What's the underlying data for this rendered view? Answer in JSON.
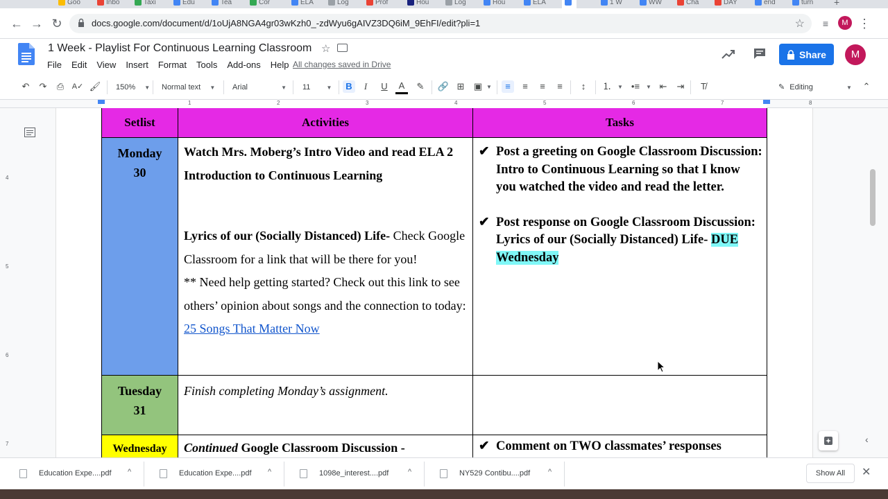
{
  "browser": {
    "tabs": [
      {
        "label": "Goo",
        "color": "#fbbc04"
      },
      {
        "label": "Inbo",
        "color": "#ea4335"
      },
      {
        "label": "Taxi",
        "color": "#34a853"
      },
      {
        "label": "Edu",
        "color": "#4285f4"
      },
      {
        "label": "Tea",
        "color": "#4285f4"
      },
      {
        "label": "Cor",
        "color": "#34a853"
      },
      {
        "label": "ELA",
        "color": "#4285f4"
      },
      {
        "label": "Log",
        "color": "#9aa0a6"
      },
      {
        "label": "Prof",
        "color": "#ea4335"
      },
      {
        "label": "Hou",
        "color": "#1a237e"
      },
      {
        "label": "Log",
        "color": "#9aa0a6"
      },
      {
        "label": "Hou",
        "color": "#4285f4"
      },
      {
        "label": "ELA",
        "color": "#4285f4"
      },
      {
        "label": "",
        "color": "#4285f4"
      },
      {
        "label": "1 W",
        "color": "#4285f4"
      },
      {
        "label": "WW",
        "color": "#4285f4"
      },
      {
        "label": "Cha",
        "color": "#ea4335"
      },
      {
        "label": "DAY",
        "color": "#ea4335"
      },
      {
        "label": "end",
        "color": "#4285f4"
      },
      {
        "label": "turn",
        "color": "#4285f4"
      }
    ],
    "url": "docs.google.com/document/d/1oUjA8NGA4gr03wKzh0_-zdWyu6gAIVZ3DQ6iM_9EhFI/edit?pli=1",
    "profile_initial": "M"
  },
  "docs": {
    "title": "1 Week - Playlist For Continuous Learning Classroom",
    "menu": [
      "File",
      "Edit",
      "View",
      "Insert",
      "Format",
      "Tools",
      "Add-ons",
      "Help"
    ],
    "save_status": "All changes saved in Drive",
    "share_label": "Share",
    "avatar_initial": "M"
  },
  "toolbar": {
    "zoom": "150%",
    "style": "Normal text",
    "font": "Arial",
    "size": "11",
    "mode": "Editing"
  },
  "ruler": [
    "1",
    "2",
    "3",
    "4",
    "5",
    "6",
    "7",
    "8"
  ],
  "vruler": [
    "4",
    "5",
    "6",
    "7"
  ],
  "table": {
    "headers": [
      "Setlist",
      "Activities",
      "Tasks"
    ],
    "monday": {
      "day": "Monday",
      "date": "30",
      "color": "#6d9eeb",
      "intro": "Watch Mrs. Moberg’s Intro Video and read ELA 2 Introduction to Continuous Learning",
      "lyrics_bold": "Lyrics of our (Socially Distanced) Life-",
      "lyrics_rest": " Check Google Classroom for a link that will be there for you!",
      "help": "** Need help getting started?  Check out this link to see others’ opinion about songs and the connection to today: ",
      "link": "25 Songs That Matter Now",
      "task1": "Post a greeting on Google Classroom Discussion:  Intro to Continuous Learning so that I know you watched the video and read the letter.",
      "task2": "Post response on Google Classroom Discussion: Lyrics of our (Socially Distanced) Life- ",
      "task2_due": "DUE Wednesday",
      "check": "✔"
    },
    "tuesday": {
      "day": "Tuesday",
      "date": "31",
      "color": "#93c47d",
      "activity": "Finish completing Monday’s assignment."
    },
    "wednesday": {
      "day": "Wednesday",
      "color": "#ffff00",
      "activity_italic": "Continued",
      "activity_rest": " Google Classroom Discussion -",
      "task": "Comment on TWO classmates’ responses"
    }
  },
  "downloads": {
    "items": [
      "Education Expe....pdf",
      "Education Expe....pdf",
      "1098e_interest....pdf",
      "NY529 Contibu....pdf"
    ],
    "show_all": "Show All"
  }
}
